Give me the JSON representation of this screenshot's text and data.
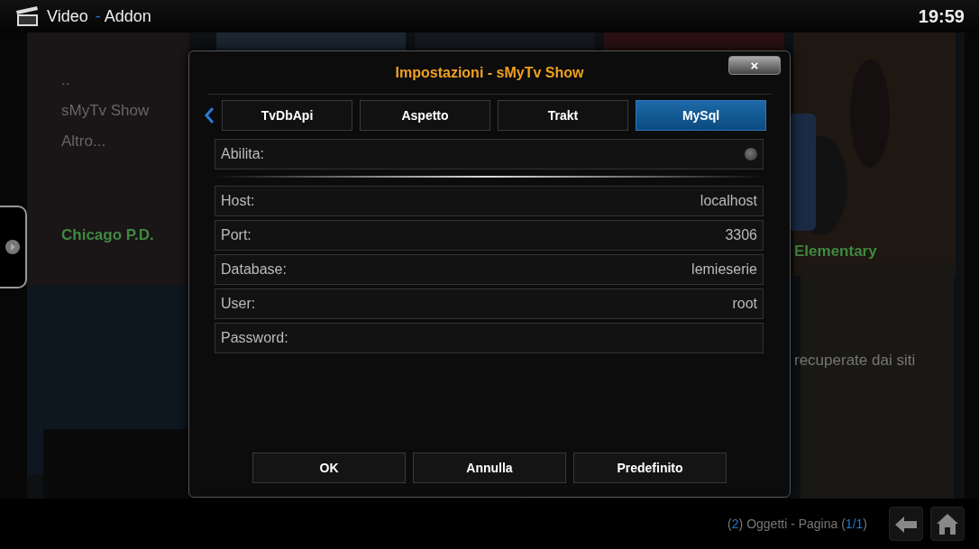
{
  "header": {
    "section": "Video",
    "separator": "-",
    "subsection": "Addon",
    "clock": "19:59"
  },
  "background": {
    "list": [
      {
        "label": ".."
      },
      {
        "label": "sMyTv Show"
      },
      {
        "label": "Altro..."
      }
    ],
    "poster_titles": [
      {
        "label": "Chicago P.D."
      },
      {
        "label": "Elementary"
      }
    ],
    "description": "recuperate dai siti"
  },
  "dialog": {
    "title": "Impostazioni - sMyTv Show",
    "close": "×",
    "tabs": [
      {
        "label": "TvDbApi",
        "selected": false
      },
      {
        "label": "Aspetto",
        "selected": false
      },
      {
        "label": "Trakt",
        "selected": false
      },
      {
        "label": "MySql",
        "selected": true
      }
    ],
    "settings": [
      {
        "kind": "toggle",
        "label": "Abilita:",
        "on": false
      },
      {
        "kind": "text",
        "label": "Host:",
        "value": "localhost"
      },
      {
        "kind": "text",
        "label": "Port:",
        "value": "3306"
      },
      {
        "kind": "text",
        "label": "Database:",
        "value": "lemieserie"
      },
      {
        "kind": "text",
        "label": "User:",
        "value": "root"
      },
      {
        "kind": "text",
        "label": "Password:"
      }
    ],
    "buttons": [
      "OK",
      "Annulla",
      "Predefinito"
    ]
  },
  "footer": {
    "page_info": [
      {
        "text": "(",
        "accent": false
      },
      {
        "text": "2",
        "accent": true
      },
      {
        "text": ") Oggetti - Pagina (",
        "accent": false
      },
      {
        "text": "1/1",
        "accent": true
      },
      {
        "text": ")",
        "accent": false
      }
    ]
  }
}
